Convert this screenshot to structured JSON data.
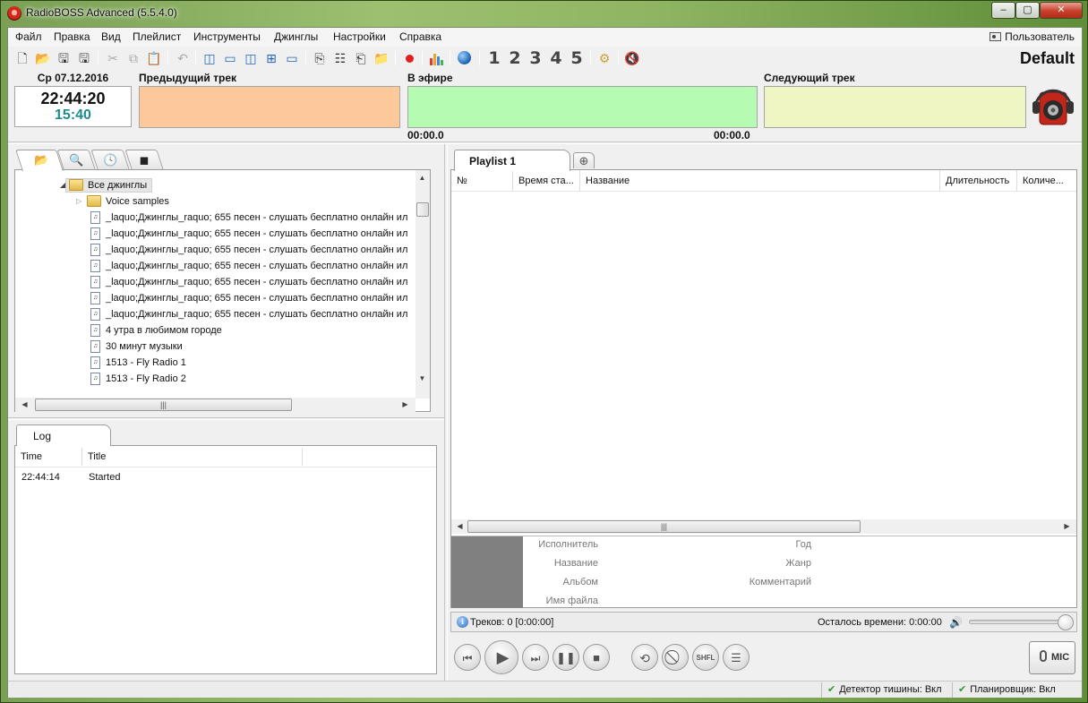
{
  "window": {
    "title": "RadioBOSS Advanced (5.5.4.0)"
  },
  "menu": {
    "items": [
      "Файл",
      "Правка",
      "Вид",
      "Плейлист",
      "Инструменты",
      "Джинглы",
      "Настройки",
      "Справка"
    ],
    "user": "Пользователь"
  },
  "toolbar": {
    "profile": "Default",
    "number_buttons": [
      "1",
      "2",
      "3",
      "4",
      "5"
    ]
  },
  "clock": {
    "date": "Ср 07.12.2016",
    "time": "22:44:20",
    "counter": "15:40"
  },
  "tracks": {
    "previous_label": "Предыдущий трек",
    "on_air_label": "В эфире",
    "next_label": "Следующий трек",
    "elapsed": "00:00.0",
    "remaining": "00:00.0"
  },
  "tree": {
    "root": "Все джинглы",
    "folder": "Voice samples",
    "files": [
      "_laquo;Джинглы_raquo; 655 песен - слушать бесплатно онлайн ил",
      "_laquo;Джинглы_raquo; 655 песен - слушать бесплатно онлайн ил",
      "_laquo;Джинглы_raquo; 655 песен - слушать бесплатно онлайн ил",
      "_laquo;Джинглы_raquo; 655 песен - слушать бесплатно онлайн ил",
      "_laquo;Джинглы_raquo; 655 песен - слушать бесплатно онлайн ил",
      "_laquo;Джинглы_raquo; 655 песен - слушать бесплатно онлайн ил",
      "_laquo;Джинглы_raquo; 655 песен - слушать бесплатно онлайн ил",
      "4 утра в любимом городе",
      "30 минут музыки",
      "1513 - Fly Radio 1",
      "1513 - Fly Radio 2"
    ]
  },
  "log": {
    "tab": "Log",
    "columns": [
      "Time",
      "Title"
    ],
    "rows": [
      {
        "time": "22:44:14",
        "title": "Started"
      }
    ]
  },
  "playlist": {
    "tab": "Playlist 1",
    "columns": [
      "№",
      "Время ста...",
      "Название",
      "Длительность",
      "Количе..."
    ],
    "tags": {
      "artist": "Исполнитель",
      "title": "Название",
      "album": "Альбом",
      "filename": "Имя файла",
      "year": "Год",
      "genre": "Жанр",
      "comment": "Комментарий"
    },
    "status_tracks": "Треков: 0 [0:00:00]",
    "status_remaining": "Осталось времени: 0:00:00",
    "volume_fraction": 1.0
  },
  "transport": {
    "shuffle": "SHFL",
    "mic": "MIC"
  },
  "statusbar": {
    "silence": "Детектор тишины: Вкл",
    "scheduler": "Планировщик: Вкл"
  }
}
